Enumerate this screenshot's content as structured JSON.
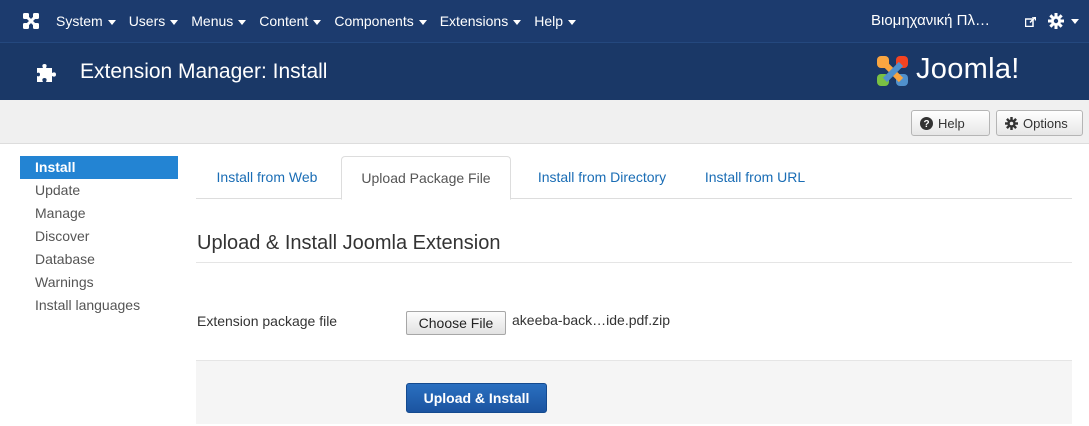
{
  "navbar": {
    "menu": [
      {
        "label": "System"
      },
      {
        "label": "Users"
      },
      {
        "label": "Menus"
      },
      {
        "label": "Content"
      },
      {
        "label": "Components"
      },
      {
        "label": "Extensions"
      },
      {
        "label": "Help"
      }
    ],
    "site_link": "Βιομηχανική Πλ…"
  },
  "header": {
    "title": "Extension Manager: Install",
    "brand": "Joomla!"
  },
  "toolbar": {
    "help_label": "Help",
    "options_label": "Options"
  },
  "sidebar": {
    "items": [
      {
        "label": "Install",
        "active": true
      },
      {
        "label": "Update"
      },
      {
        "label": "Manage"
      },
      {
        "label": "Discover"
      },
      {
        "label": "Database"
      },
      {
        "label": "Warnings"
      },
      {
        "label": "Install languages"
      }
    ]
  },
  "tabs": [
    {
      "label": "Install from Web"
    },
    {
      "label": "Upload Package File",
      "active": true
    },
    {
      "label": "Install from Directory"
    },
    {
      "label": "Install from URL"
    }
  ],
  "main": {
    "section_title": "Upload & Install Joomla Extension",
    "field_label": "Extension package file",
    "choose_file_label": "Choose File",
    "file_name": "akeeba-back…ide.pdf.zip",
    "upload_label": "Upload & Install"
  },
  "colors": {
    "navbar_bg": "#1c3b6e",
    "header_bg": "#1a3867",
    "accent": "#2384d3",
    "link": "#1a6db5"
  },
  "icons": [
    "joomla-logo-icon",
    "external-link-icon",
    "gear-icon",
    "puzzle-piece-icon",
    "question-circle-icon"
  ]
}
